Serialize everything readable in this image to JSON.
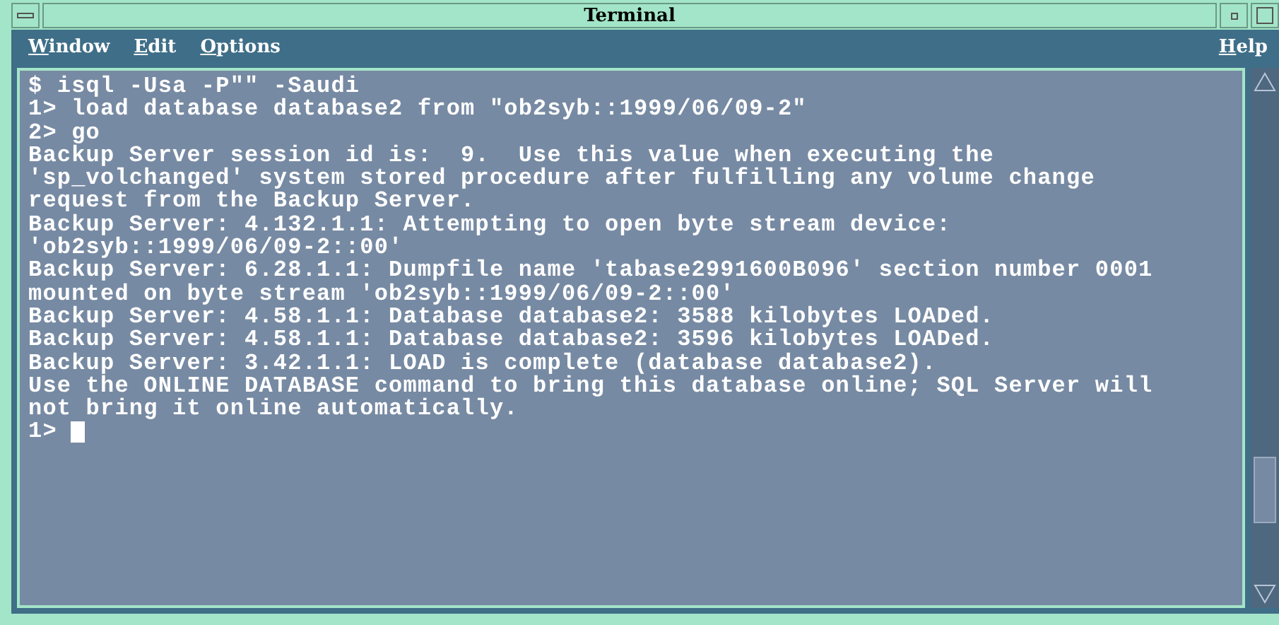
{
  "window": {
    "title": "Terminal"
  },
  "menu": {
    "left": [
      "Window",
      "Edit",
      "Options"
    ],
    "right": [
      "Help"
    ]
  },
  "terminal": {
    "lines": [
      "$ isql -Usa -P\"\" -Saudi",
      "1> load database database2 from \"ob2syb::1999/06/09-2\"",
      "2> go",
      "Backup Server session id is:  9.  Use this value when executing the",
      "'sp_volchanged' system stored procedure after fulfilling any volume change",
      "request from the Backup Server.",
      "Backup Server: 4.132.1.1: Attempting to open byte stream device:",
      "'ob2syb::1999/06/09-2::00'",
      "Backup Server: 6.28.1.1: Dumpfile name 'tabase2991600B096' section number 0001",
      "mounted on byte stream 'ob2syb::1999/06/09-2::00'",
      "Backup Server: 4.58.1.1: Database database2: 3588 kilobytes LOADed.",
      "Backup Server: 4.58.1.1: Database database2: 3596 kilobytes LOADed.",
      "Backup Server: 3.42.1.1: LOAD is complete (database database2).",
      "Use the ONLINE DATABASE command to bring this database online; SQL Server will",
      "not bring it online automatically."
    ],
    "prompt": "1>"
  }
}
